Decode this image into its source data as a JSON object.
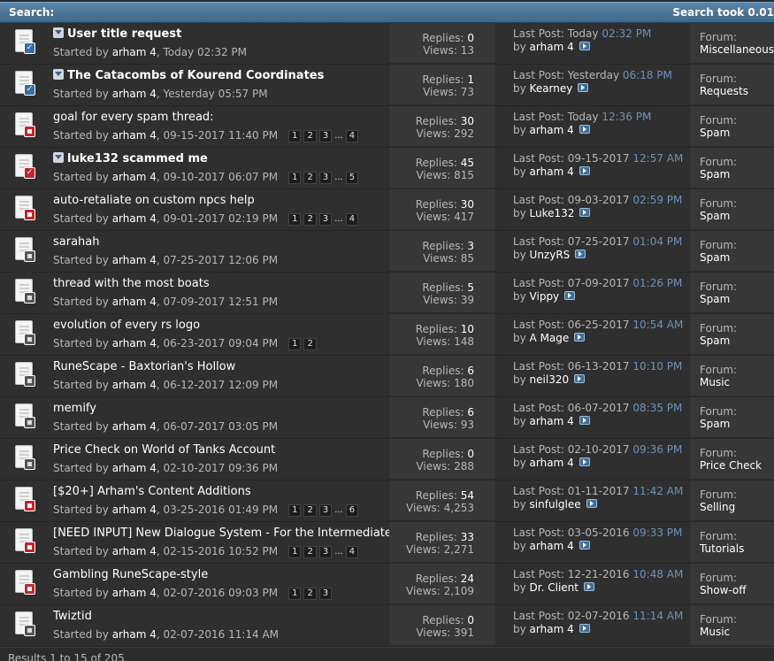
{
  "header": {
    "title": "Search:",
    "took": "Search took 0.01"
  },
  "labels": {
    "started_by": "Started by",
    "replies": "Replies:",
    "views": "Views:",
    "last_post": "Last Post:",
    "by": "by",
    "forum": "Forum:"
  },
  "threads": [
    {
      "sticky": true,
      "bold": true,
      "icon": "check-blue",
      "title": "User title request",
      "starter": "arham 4",
      "started": "Today 02:32 PM",
      "pages": [],
      "replies": "0",
      "views": "13",
      "last_date": "Today",
      "last_time": "02:32 PM",
      "last_user": "arham 4",
      "forum": "Miscellaneous"
    },
    {
      "sticky": true,
      "bold": true,
      "icon": "check-blue",
      "title": "The Catacombs of Kourend Coordinates",
      "starter": "arham 4",
      "started": "Yesterday 05:57 PM",
      "pages": [],
      "replies": "1",
      "views": "73",
      "last_date": "Yesterday",
      "last_time": "06:18 PM",
      "last_user": "Kearney",
      "forum": "Requests"
    },
    {
      "sticky": false,
      "bold": false,
      "icon": "red",
      "title": "goal for every spam thread:",
      "starter": "arham 4",
      "started": "09-15-2017 11:40 PM",
      "pages": [
        "1",
        "2",
        "3",
        "...",
        "4"
      ],
      "replies": "30",
      "views": "292",
      "last_date": "Today",
      "last_time": "12:36 PM",
      "last_user": "arham 4",
      "forum": "Spam"
    },
    {
      "sticky": true,
      "bold": true,
      "icon": "check-red",
      "title": "luke132 scammed me",
      "starter": "arham 4",
      "started": "09-10-2017 06:07 PM",
      "pages": [
        "1",
        "2",
        "3",
        "...",
        "5"
      ],
      "replies": "45",
      "views": "815",
      "last_date": "09-15-2017",
      "last_time": "12:57 AM",
      "last_user": "arham 4",
      "forum": "Spam"
    },
    {
      "sticky": false,
      "bold": false,
      "icon": "red",
      "title": "auto-retaliate on custom npcs help",
      "starter": "arham 4",
      "started": "09-01-2017 02:19 PM",
      "pages": [
        "1",
        "2",
        "3",
        "...",
        "4"
      ],
      "replies": "30",
      "views": "417",
      "last_date": "09-03-2017",
      "last_time": "02:59 PM",
      "last_user": "Luke132",
      "forum": "Spam"
    },
    {
      "sticky": false,
      "bold": false,
      "icon": "gray",
      "title": "sarahah",
      "starter": "arham 4",
      "started": "07-25-2017 12:06 PM",
      "pages": [],
      "replies": "3",
      "views": "85",
      "last_date": "07-25-2017",
      "last_time": "01:04 PM",
      "last_user": "UnzyRS",
      "forum": "Spam"
    },
    {
      "sticky": false,
      "bold": false,
      "icon": "gray",
      "title": "thread with the most boats",
      "starter": "arham 4",
      "started": "07-09-2017 12:51 PM",
      "pages": [],
      "replies": "5",
      "views": "39",
      "last_date": "07-09-2017",
      "last_time": "01:26 PM",
      "last_user": "Vippy",
      "forum": "Spam"
    },
    {
      "sticky": false,
      "bold": false,
      "icon": "gray",
      "title": "evolution of every rs logo",
      "starter": "arham 4",
      "started": "06-23-2017 09:04 PM",
      "pages": [
        "1",
        "2"
      ],
      "replies": "10",
      "views": "148",
      "last_date": "06-25-2017",
      "last_time": "10:54 AM",
      "last_user": "A Mage",
      "forum": "Spam"
    },
    {
      "sticky": false,
      "bold": false,
      "icon": "gray",
      "title": "RuneScape - Baxtorian's Hollow",
      "starter": "arham 4",
      "started": "06-12-2017 12:09 PM",
      "pages": [],
      "replies": "6",
      "views": "180",
      "last_date": "06-13-2017",
      "last_time": "10:10 PM",
      "last_user": "neil320",
      "forum": "Music"
    },
    {
      "sticky": false,
      "bold": false,
      "icon": "gray",
      "title": "memify",
      "starter": "arham 4",
      "started": "06-07-2017 03:05 PM",
      "pages": [],
      "replies": "6",
      "views": "93",
      "last_date": "06-07-2017",
      "last_time": "08:35 PM",
      "last_user": "arham 4",
      "forum": "Spam"
    },
    {
      "sticky": false,
      "bold": false,
      "icon": "gray",
      "title": "Price Check on World of Tanks Account",
      "starter": "arham 4",
      "started": "02-10-2017 09:36 PM",
      "pages": [],
      "replies": "0",
      "views": "288",
      "last_date": "02-10-2017",
      "last_time": "09:36 PM",
      "last_user": "arham 4",
      "forum": "Price Check"
    },
    {
      "sticky": false,
      "bold": false,
      "icon": "red",
      "title": "[$20+] Arham's Content Additions",
      "starter": "arham 4",
      "started": "03-25-2016 01:49 PM",
      "pages": [
        "1",
        "2",
        "3",
        "...",
        "6"
      ],
      "replies": "54",
      "views": "4,253",
      "last_date": "01-11-2017",
      "last_time": "11:42 AM",
      "last_user": "sinfulglee",
      "forum": "Selling"
    },
    {
      "sticky": false,
      "bold": false,
      "icon": "red",
      "title": "[NEED INPUT] New Dialogue System - For the Intermediate",
      "starter": "arham 4",
      "started": "02-15-2016 10:52 PM",
      "pages": [
        "1",
        "2",
        "3",
        "...",
        "4"
      ],
      "replies": "33",
      "views": "2,271",
      "last_date": "03-05-2016",
      "last_time": "09:33 PM",
      "last_user": "arham 4",
      "forum": "Tutorials"
    },
    {
      "sticky": false,
      "bold": false,
      "icon": "red",
      "title": "Gambling RuneScape-style",
      "starter": "arham 4",
      "started": "02-07-2016 09:03 PM",
      "pages": [
        "1",
        "2",
        "3"
      ],
      "replies": "24",
      "views": "2,109",
      "last_date": "12-21-2016",
      "last_time": "10:48 AM",
      "last_user": "Dr. Client",
      "forum": "Show-off"
    },
    {
      "sticky": false,
      "bold": false,
      "icon": "gray",
      "title": "Twiztid",
      "starter": "arham 4",
      "started": "02-07-2016 11:14 AM",
      "pages": [],
      "replies": "0",
      "views": "391",
      "last_date": "02-07-2016",
      "last_time": "11:14 AM",
      "last_user": "arham 4",
      "forum": "Music"
    }
  ],
  "footer": {
    "results": "Results 1 to 15 of 205"
  }
}
